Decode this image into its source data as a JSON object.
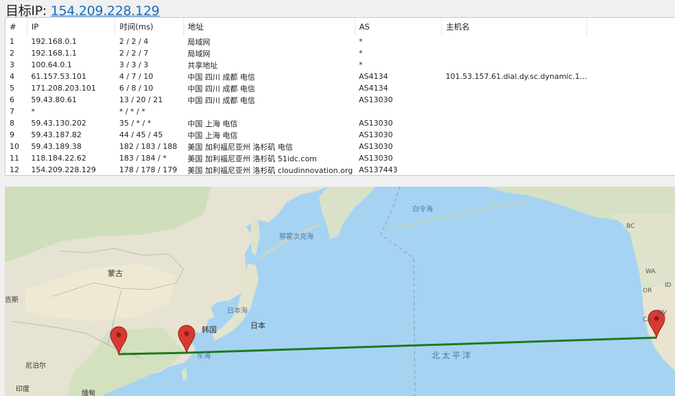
{
  "header": {
    "label": "目标IP:",
    "ip": "154.209.228.129"
  },
  "table": {
    "columns": [
      "#",
      "IP",
      "时间(ms)",
      "地址",
      "AS",
      "主机名"
    ],
    "rows": [
      [
        "1",
        "192.168.0.1",
        "2 / 2 / 4",
        "局域网",
        "*",
        ""
      ],
      [
        "2",
        "192.168.1.1",
        "2 / 2 / 7",
        "局域网",
        "*",
        ""
      ],
      [
        "3",
        "100.64.0.1",
        "3 / 3 / 3",
        "共享地址",
        "*",
        ""
      ],
      [
        "4",
        "61.157.53.101",
        "4 / 7 / 10",
        "中国 四川 成都 电信",
        "AS4134",
        "101.53.157.61.dial.dy.sc.dynamic.1..."
      ],
      [
        "5",
        "171.208.203.101",
        "6 / 8 / 10",
        "中国 四川 成都 电信",
        "AS4134",
        ""
      ],
      [
        "6",
        "59.43.80.61",
        "13 / 20 / 21",
        "中国 四川 成都 电信",
        "AS13030",
        ""
      ],
      [
        "7",
        "*",
        "* / * / *",
        "",
        "",
        ""
      ],
      [
        "8",
        "59.43.130.202",
        "35 / * / *",
        "中国 上海 电信",
        "AS13030",
        ""
      ],
      [
        "9",
        "59.43.187.82",
        "44 / 45 / 45",
        "中国 上海 电信",
        "AS13030",
        ""
      ],
      [
        "10",
        "59.43.189.38",
        "182 / 183 / 188",
        "美国 加利福尼亚州 洛杉矶 电信",
        "AS13030",
        ""
      ],
      [
        "11",
        "118.184.22.62",
        "183 / 184 / *",
        "美国 加利福尼亚州 洛杉矶 51idc.com",
        "AS13030",
        ""
      ],
      [
        "12",
        "154.209.228.129",
        "178 / 178 / 179",
        "美国 加利福尼亚州 洛杉矶 cloudinnovation.org",
        "AS137443",
        ""
      ]
    ]
  },
  "map": {
    "labels": {
      "bering": "白令海",
      "okhotsk": "鄂霍次克海",
      "mongolia": "蒙古",
      "kazakh": "吉斯",
      "xinjiang": "吉斯",
      "japan_sea": "日本海",
      "japan": "日本",
      "korea": "韩国",
      "east_sea": "东海",
      "pacific": "北太平洋",
      "india": "印度",
      "nepal": "尼泊尔",
      "myanmar": "缅甸",
      "bc": "BC",
      "wa": "WA",
      "or": "OR",
      "nv": "NV",
      "id": "ID",
      "ca": "CA"
    },
    "colors": {
      "ocean": "#a6d3f2",
      "land": "#e9e6d6",
      "route": "#1c7a1c",
      "marker": "#d83a33"
    }
  }
}
